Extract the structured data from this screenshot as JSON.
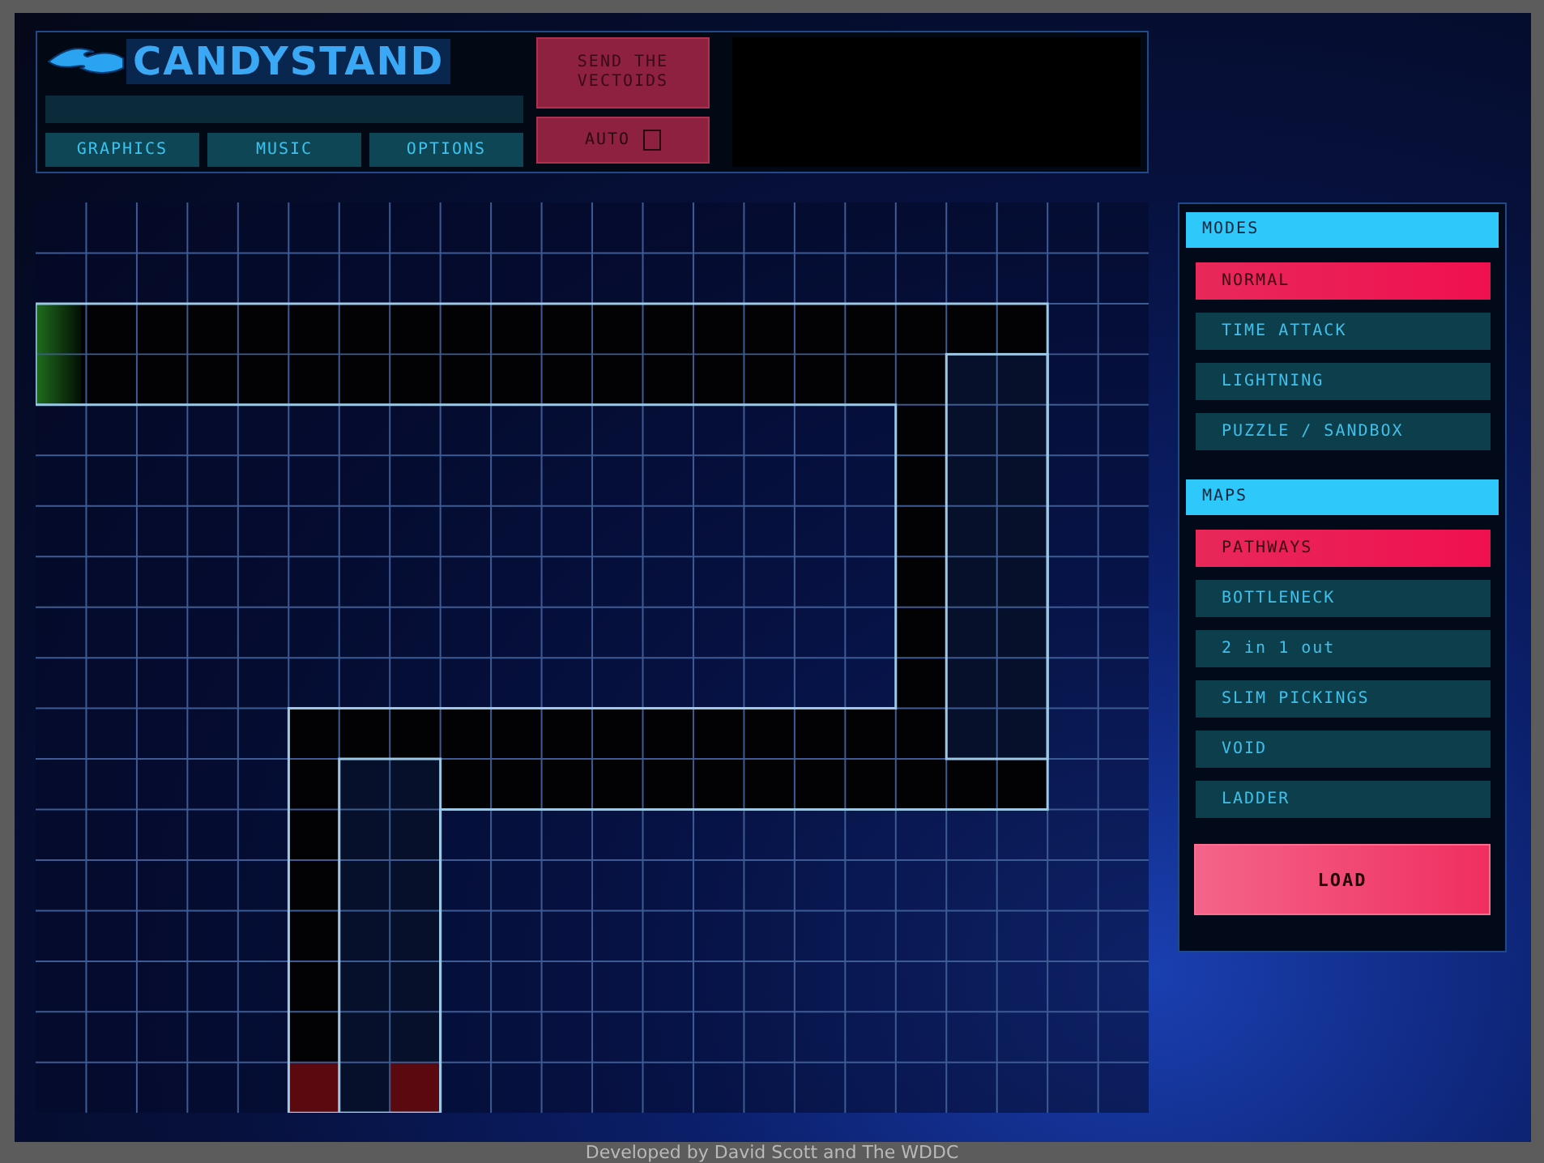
{
  "header": {
    "logo": "CANDYSTAND",
    "menu_buttons": [
      {
        "label": "GRAPHICS"
      },
      {
        "label": "MUSIC"
      },
      {
        "label": "OPTIONS"
      }
    ],
    "send_button": "SEND THE VECTOIDS",
    "auto": {
      "label": "AUTO",
      "checked": false
    }
  },
  "modes": {
    "title": "MODES",
    "items": [
      {
        "label": "NORMAL",
        "selected": true
      },
      {
        "label": "TIME ATTACK",
        "selected": false
      },
      {
        "label": "LIGHTNING",
        "selected": false
      },
      {
        "label": "PUZZLE / SANDBOX",
        "selected": false
      }
    ]
  },
  "maps": {
    "title": "MAPS",
    "items": [
      {
        "label": "PATHWAYS",
        "selected": true
      },
      {
        "label": "BOTTLENECK",
        "selected": false
      },
      {
        "label": "2 in 1 out",
        "selected": false
      },
      {
        "label": "SLIM PICKINGS",
        "selected": false
      },
      {
        "label": "VOID",
        "selected": false
      },
      {
        "label": "LADDER",
        "selected": false
      }
    ]
  },
  "load_button": "LOAD",
  "footer": "Developed by David Scott and The WDDC"
}
